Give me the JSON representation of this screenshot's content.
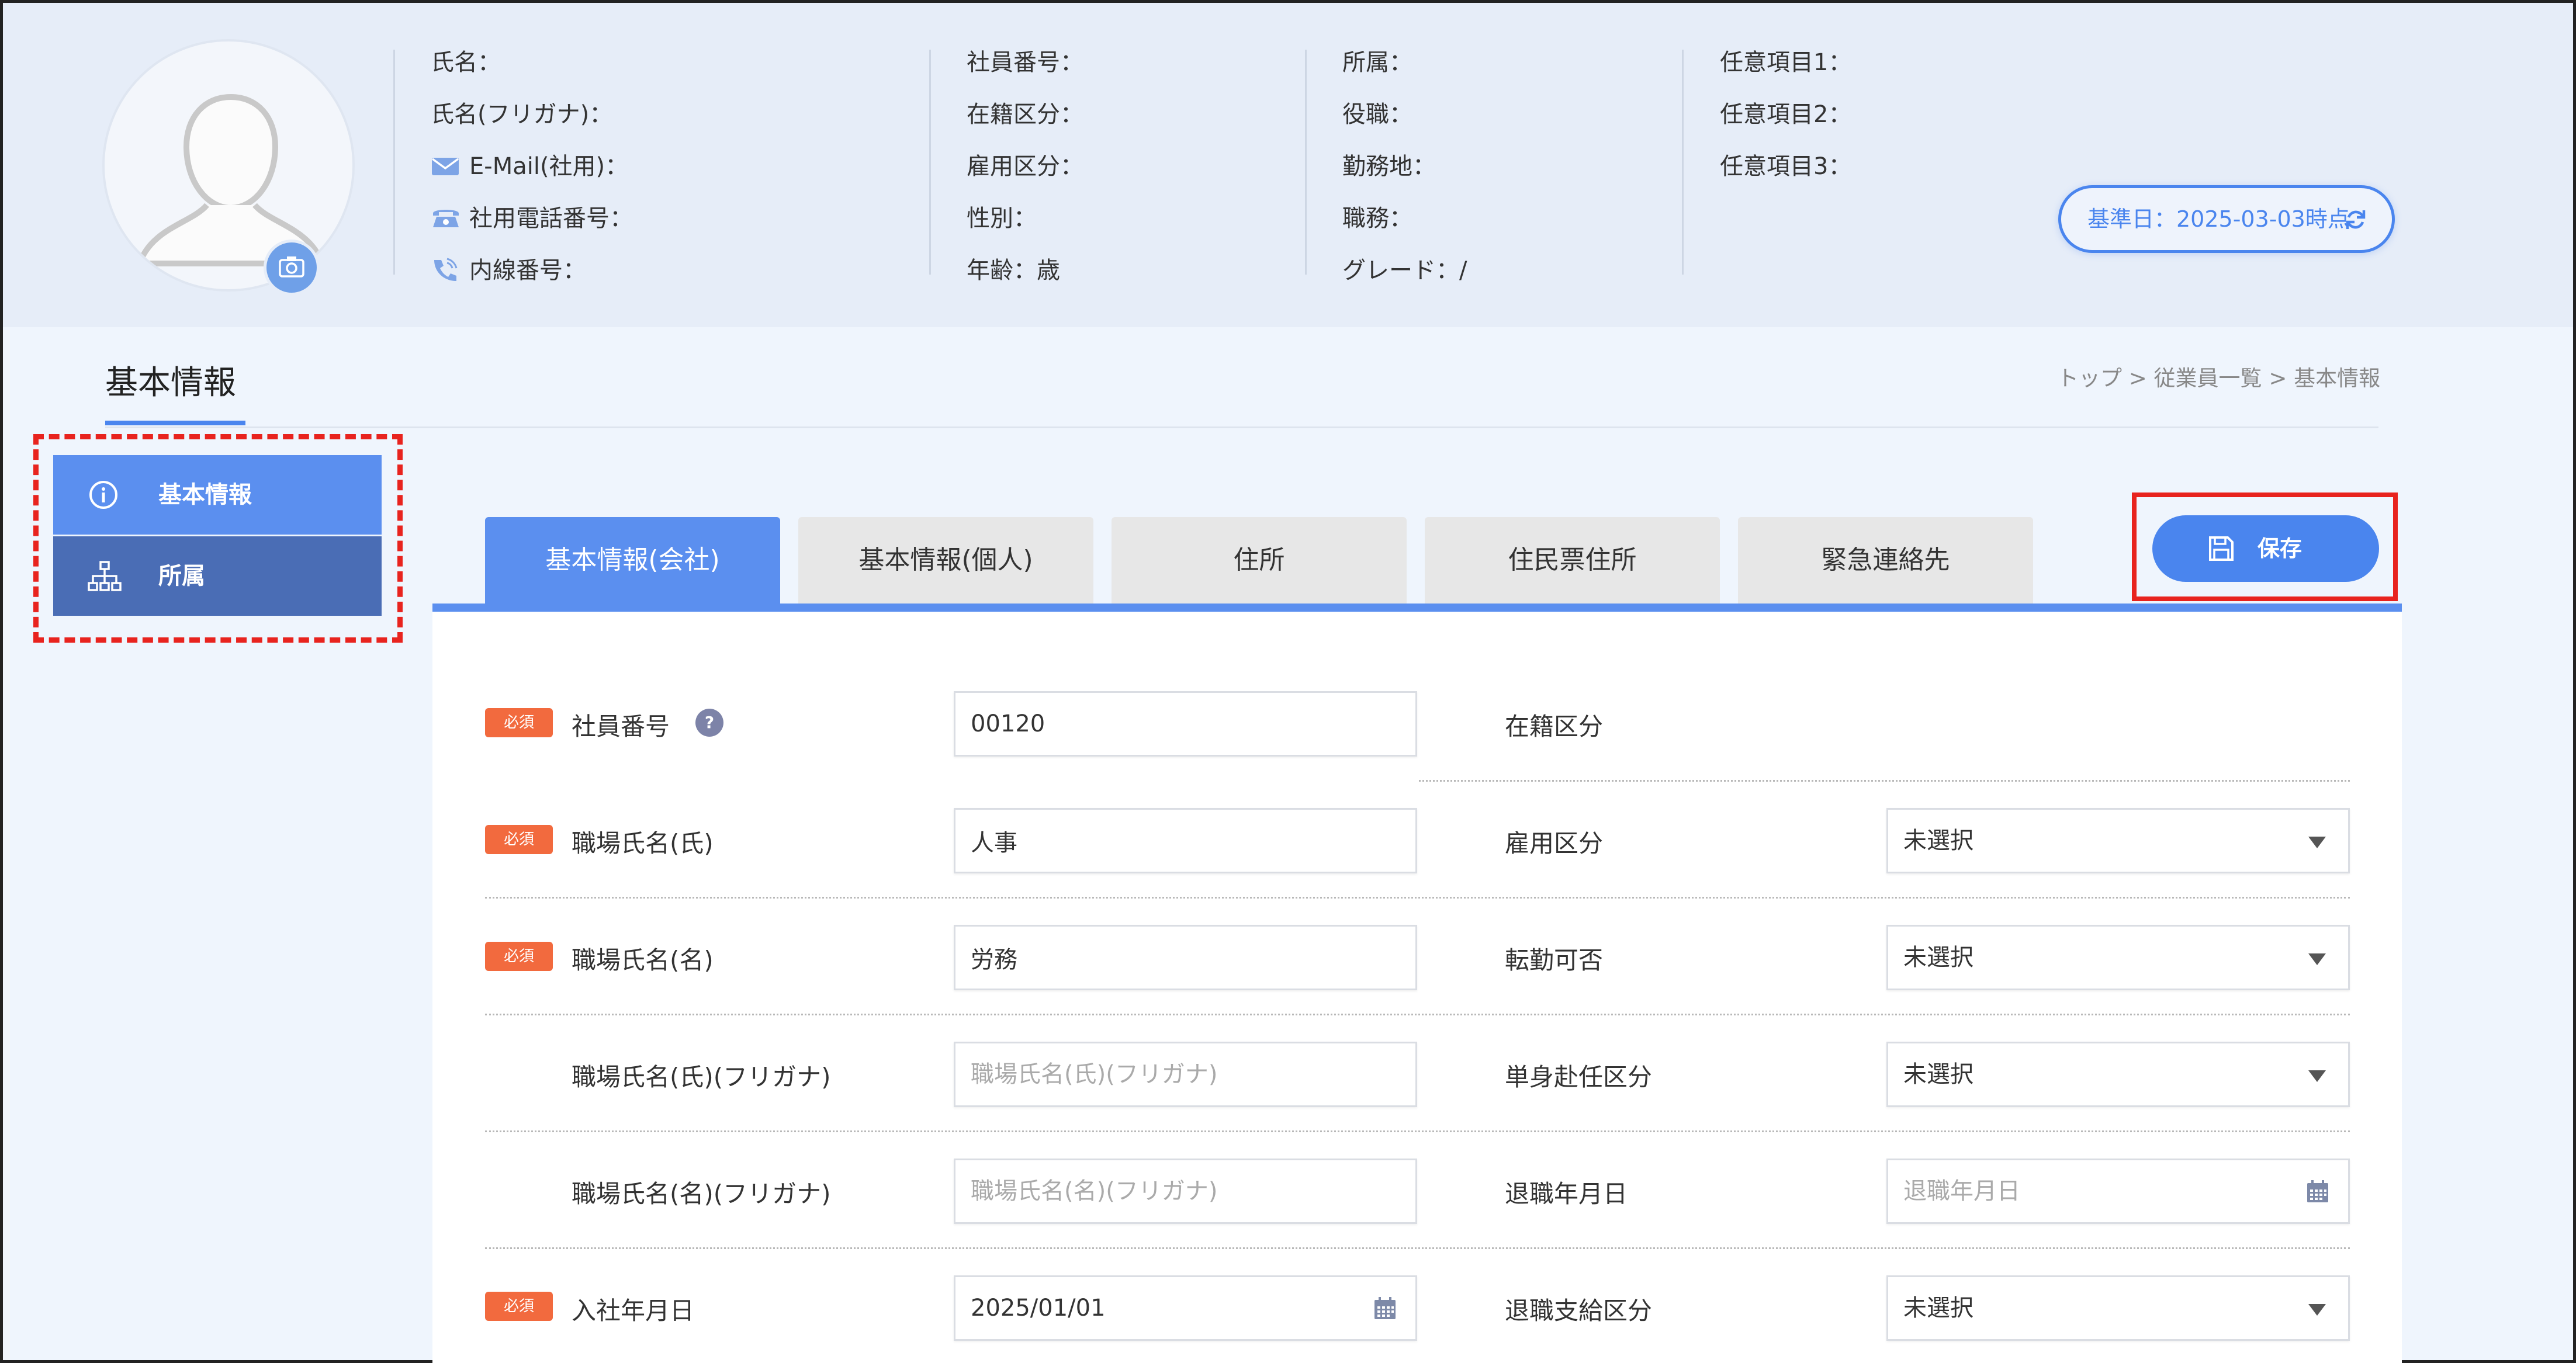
{
  "header": {
    "col1": [
      {
        "label": "氏名：",
        "icon": ""
      },
      {
        "label": "氏名(フリガナ)：",
        "icon": ""
      },
      {
        "label": "E-Mail(社用)：",
        "icon": "mail-icon"
      },
      {
        "label": "社用電話番号：",
        "icon": "telephone-icon"
      },
      {
        "label": "内線番号：",
        "icon": "phone-handset-icon"
      }
    ],
    "col2": [
      "社員番号：",
      "在籍区分：",
      "雇用区分：",
      "性別：",
      "年齢：歳"
    ],
    "col3": [
      "所属：",
      "役職：",
      "勤務地：",
      "職務：",
      "グレード：/"
    ],
    "col4": [
      "任意項目1：",
      "任意項目2：",
      "任意項目3："
    ],
    "kijun": "基準日：2025-03-03時点",
    "colors": {
      "accent": "#4a85ee",
      "header_bg": "#e6edf8"
    }
  },
  "page": {
    "title": "基本情報",
    "breadcrumb": {
      "top": "トップ",
      "sep": ">",
      "list": "従業員一覧",
      "current": "基本情報"
    }
  },
  "sidebar": {
    "items": [
      {
        "label": "基本情報",
        "icon": "info-circle-icon"
      },
      {
        "label": "所属",
        "icon": "org-chart-icon"
      }
    ]
  },
  "tabs": [
    "基本情報(会社)",
    "基本情報(個人)",
    "住所",
    "住民票住所",
    "緊急連絡先"
  ],
  "save_label": "保存",
  "form": {
    "required_badge": "必須",
    "help": "?",
    "left": [
      {
        "label": "社員番号",
        "required": true,
        "value": "00120",
        "placeholder": ""
      },
      {
        "label": "職場氏名(氏)",
        "required": true,
        "value": "人事",
        "placeholder": ""
      },
      {
        "label": "職場氏名(名)",
        "required": true,
        "value": "労務",
        "placeholder": ""
      },
      {
        "label": "職場氏名(氏)(フリガナ)",
        "required": false,
        "value": "",
        "placeholder": "職場氏名(氏)(フリガナ)"
      },
      {
        "label": "職場氏名(名)(フリガナ)",
        "required": false,
        "value": "",
        "placeholder": "職場氏名(名)(フリガナ)"
      },
      {
        "label": "入社年月日",
        "required": true,
        "value": "2025/01/01",
        "placeholder": ""
      }
    ],
    "right": [
      {
        "label": "在籍区分",
        "value": ""
      },
      {
        "label": "雇用区分",
        "value": "未選択"
      },
      {
        "label": "転勤可否",
        "value": "未選択"
      },
      {
        "label": "単身赴任区分",
        "value": "未選択"
      },
      {
        "label": "退職年月日",
        "value": "",
        "placeholder": "退職年月日"
      },
      {
        "label": "退職支給区分",
        "value": "未選択"
      }
    ]
  }
}
